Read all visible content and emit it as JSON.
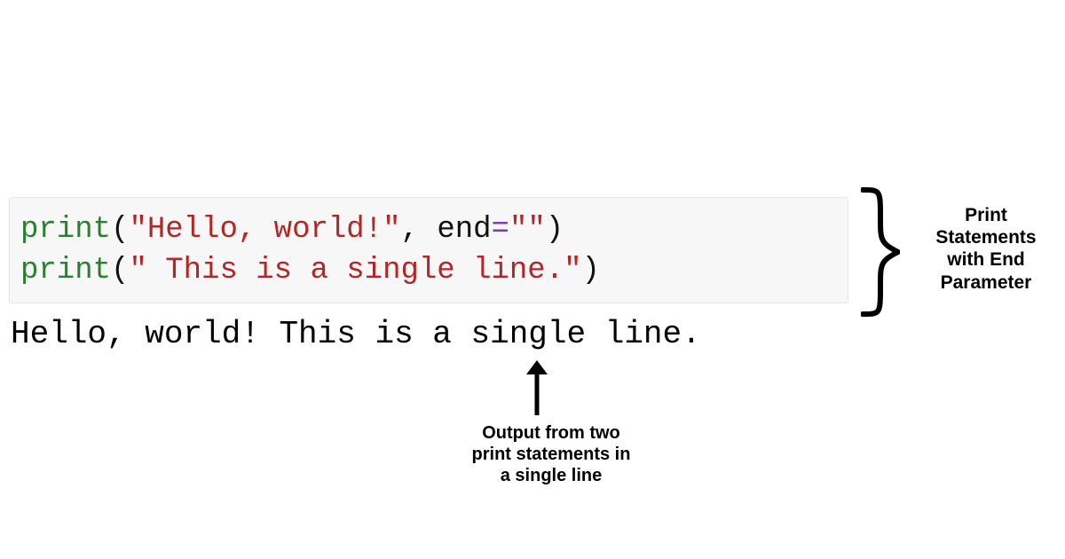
{
  "code": {
    "line1": {
      "fn": "print",
      "open": "(",
      "str": "\"Hello, world!\"",
      "sep": ", ",
      "kw": "end",
      "eq": "=",
      "arg": "\"\"",
      "close": ")"
    },
    "line2": {
      "fn": "print",
      "open": "(",
      "str": "\" This is a single line.\"",
      "close": ")"
    }
  },
  "output": "Hello, world! This is a single line.",
  "annotations": {
    "brace_label": "Print Statements with End Parameter",
    "arrow_label": "Output from two print statements in a single line"
  }
}
